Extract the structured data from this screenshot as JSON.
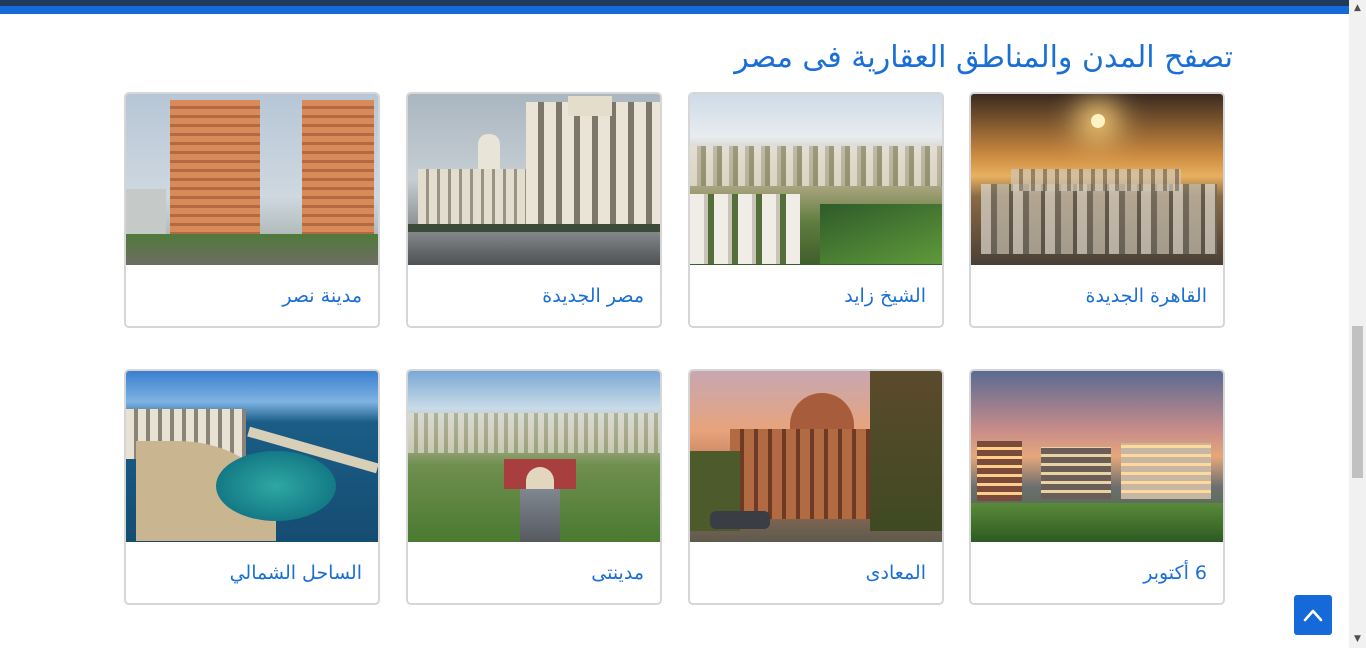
{
  "section": {
    "title": "تصفح المدن والمناطق العقارية فى مصر"
  },
  "cities": [
    {
      "name": "القاهرة الجديدة"
    },
    {
      "name": "الشيخ زايد"
    },
    {
      "name": "مصر الجديدة"
    },
    {
      "name": "مدينة نصر"
    },
    {
      "name": "6 أكتوبر"
    },
    {
      "name": "المعادى"
    },
    {
      "name": "مدينتى"
    },
    {
      "name": "الساحل الشمالي"
    }
  ],
  "colors": {
    "accent": "#1a6fd6",
    "top_bar_dark": "#1f3a5a",
    "top_bar_blue": "#1669d9",
    "back_to_top_bg": "#1669d9"
  },
  "icons": {
    "back_to_top": "chevron-up-icon",
    "scroll_up": "scroll-up-arrow-icon",
    "scroll_down": "scroll-down-arrow-icon"
  }
}
